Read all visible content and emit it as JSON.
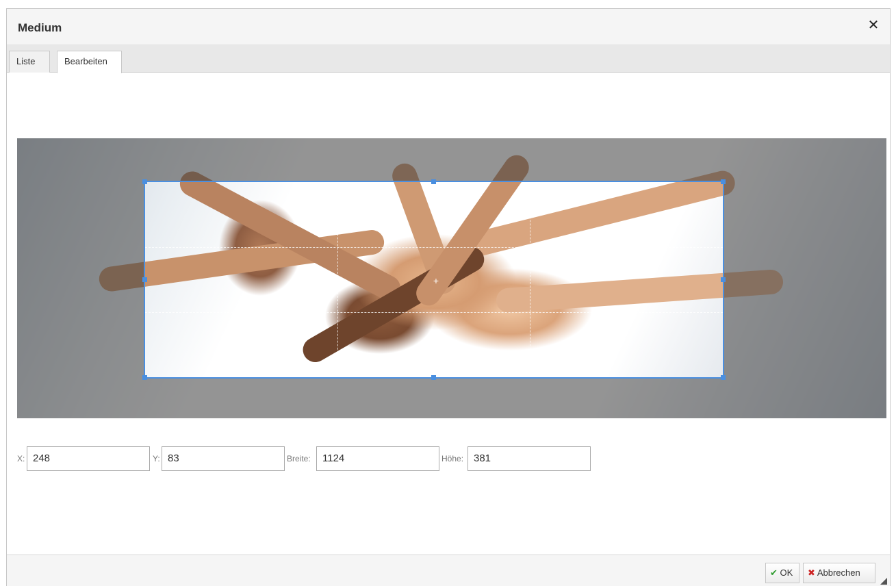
{
  "dialog": {
    "title": "Medium",
    "close_symbol": "✕"
  },
  "tabs": [
    {
      "label": "Liste"
    },
    {
      "label": "Bearbeiten"
    }
  ],
  "crop": {
    "x_label": "X:",
    "x_value": "248",
    "y_label": "Y:",
    "y_value": "83",
    "width_label": "Breite:",
    "width_value": "1124",
    "height_label": "Höhe:",
    "height_value": "381"
  },
  "footer": {
    "ok_icon": "✔",
    "ok_label": "OK",
    "cancel_icon": "✖",
    "cancel_label": "Abbrechen"
  },
  "colors": {
    "accent": "#4a8fe0",
    "ok_icon": "#2e9b2e",
    "cancel_icon": "#cc2222"
  }
}
